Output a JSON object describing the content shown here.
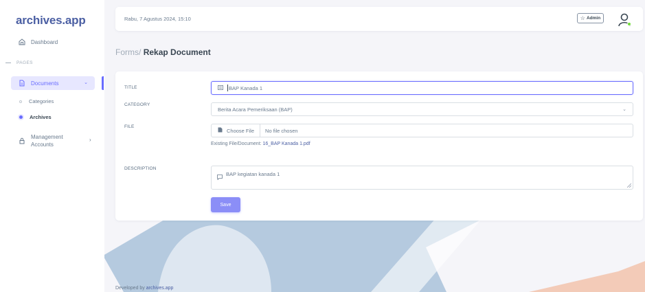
{
  "app": {
    "brand": "archives.app"
  },
  "sidebar": {
    "dashboard_label": "Dashboard",
    "section_header": "PAGES",
    "documents_label": "Documents",
    "sub_items": [
      {
        "label": "Categories",
        "active": false
      },
      {
        "label": "Archives",
        "active": true
      }
    ],
    "management_label_line1": "Management",
    "management_label_line2": "Accounts"
  },
  "topbar": {
    "datetime": "Rabu, 7 Agustus 2024, 15:10",
    "admin_label": "Admin"
  },
  "breadcrumb": {
    "parent": "Forms/",
    "current": "Rekap Document"
  },
  "form": {
    "title_label": "TITLE",
    "title_value": "BAP Kanada 1",
    "category_label": "CATEGORY",
    "category_value": "Berita Acara Pemeriksaan (BAP)",
    "file_label": "FILE",
    "file_button": "Choose File",
    "file_status": "No file chosen",
    "existing_prefix": "Existing File/Document: ",
    "existing_file": "16_BAP Kanada 1.pdf",
    "description_label": "DESCRIPTION",
    "description_value": "BAP kegiatan kanada 1",
    "save_label": "Save"
  },
  "footer": {
    "prefix": "Developed by ",
    "link": "archives.app"
  },
  "colors": {
    "primary": "#696cff",
    "brand": "#4b5fa3",
    "online": "#71dd37"
  }
}
